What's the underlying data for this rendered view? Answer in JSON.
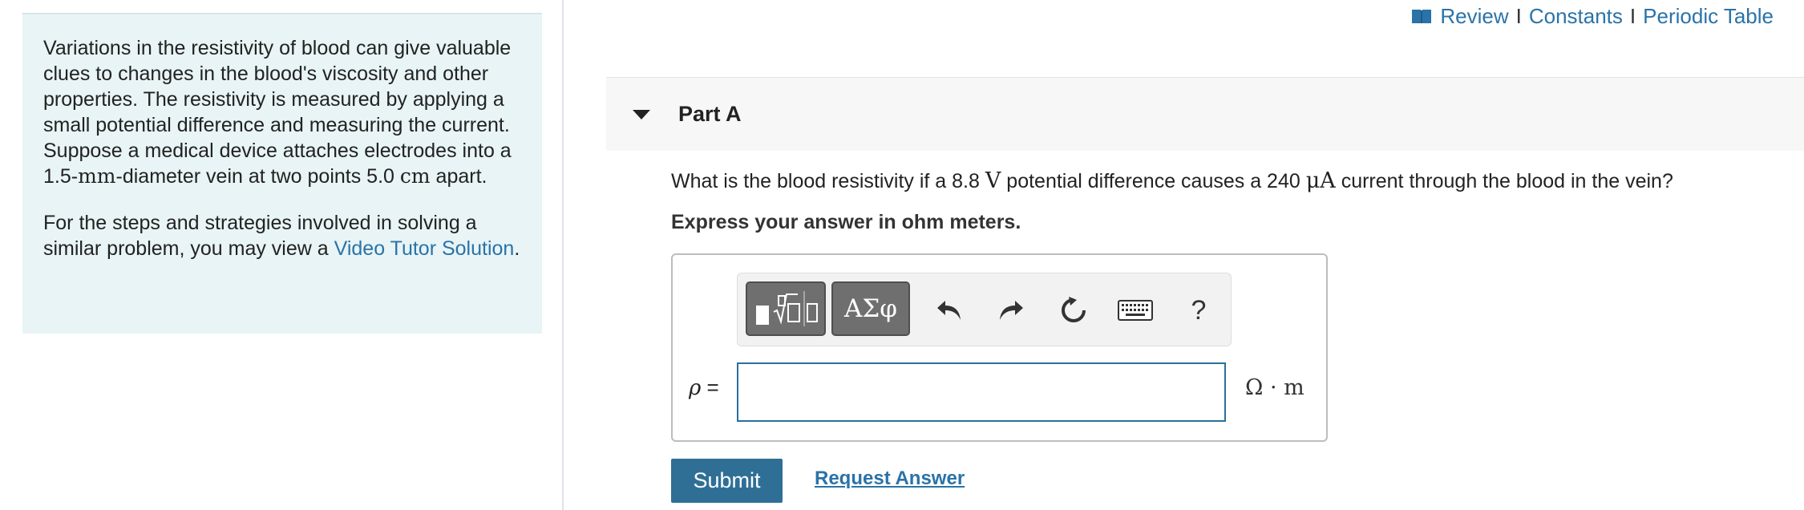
{
  "left_panel": {
    "para1_a": "Variations in the resistivity of blood can give valuable clues to changes in the blood's viscosity and other properties. The resistivity is measured by applying a small potential difference and measuring the current. Suppose a medical device attaches electrodes into a 1.5-",
    "para1_unit_mm": "mm",
    "para1_b": "-diameter vein at two points 5.0 ",
    "para1_unit_cm": "cm",
    "para1_c": " apart.",
    "para2_a": "For the steps and strategies involved in solving a similar problem, you may view a ",
    "para2_link": "Video Tutor Solution",
    "para2_end": "."
  },
  "top_links": {
    "icon": "book-icon",
    "review": "Review",
    "constants": "Constants",
    "periodic_table": "Periodic Table",
    "separator": "I"
  },
  "part": {
    "title": "Part A",
    "q_a": "What is the blood resistivity if a 8.8 ",
    "q_unit_v": "V",
    "q_b": " potential difference causes a 240 ",
    "q_unit_ua": "μA",
    "q_c": " current through the blood in the vein?",
    "instruction": "Express your answer in ohm meters."
  },
  "toolbar": {
    "greek_label": "ΑΣφ",
    "help_label": "?",
    "icons": [
      "templates-icon",
      "undo-icon",
      "redo-icon",
      "reset-icon",
      "keyboard-icon"
    ]
  },
  "answer": {
    "var_symbol": "ρ",
    "equals": " =",
    "value": "",
    "unit": "Ω · m"
  },
  "actions": {
    "submit_label": "Submit",
    "request_label": "Request Answer"
  },
  "colors": {
    "panel_bg": "#e8f4f5",
    "link": "#2a73a8",
    "submit_bg": "#2f6f96",
    "input_border": "#2a6f9e"
  }
}
